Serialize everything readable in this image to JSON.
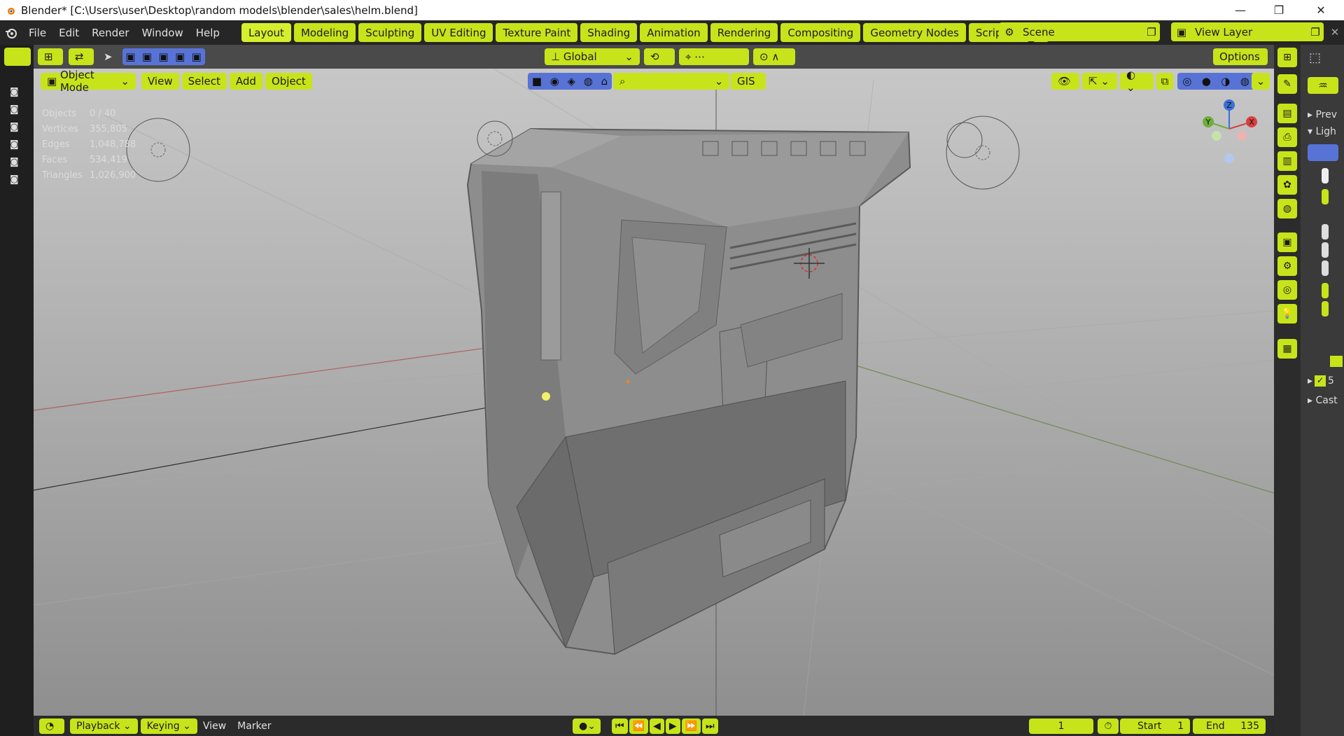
{
  "window": {
    "title": "Blender* [C:\\Users\\user\\Desktop\\random models\\blender\\sales\\helm.blend]"
  },
  "menu": {
    "items": [
      "File",
      "Edit",
      "Render",
      "Window",
      "Help"
    ]
  },
  "workspaces": [
    "Layout",
    "Modeling",
    "Sculpting",
    "UV Editing",
    "Texture Paint",
    "Shading",
    "Animation",
    "Rendering",
    "Compositing",
    "Geometry Nodes",
    "Scripting"
  ],
  "active_workspace": "Layout",
  "scene": {
    "label": "Scene"
  },
  "view_layer": {
    "label": "View Layer"
  },
  "viewport": {
    "mode": "Object Mode",
    "menus": [
      "View",
      "Select",
      "Add",
      "Object"
    ],
    "transform_orientation": "Global",
    "gis_label": "GIS",
    "options_label": "Options",
    "stats": [
      {
        "label": "Objects",
        "value": "0 / 40"
      },
      {
        "label": "Vertices",
        "value": "355,805"
      },
      {
        "label": "Edges",
        "value": "1,048,788"
      },
      {
        "label": "Faces",
        "value": "534,419"
      },
      {
        "label": "Triangles",
        "value": "1,026,900"
      }
    ],
    "gizmo": {
      "z": "Z",
      "y": "Y",
      "x": "X"
    }
  },
  "properties": {
    "items": [
      "Prev",
      "Ligh",
      "5",
      "Cast"
    ]
  },
  "timeline": {
    "playback": "Playback",
    "keying": "Keying",
    "view": "View",
    "marker": "Marker",
    "current_frame": "1",
    "start_label": "Start",
    "start": "1",
    "end_label": "End",
    "end": "135"
  },
  "colors": {
    "accent": "#c7e41a",
    "header": "#262626"
  }
}
